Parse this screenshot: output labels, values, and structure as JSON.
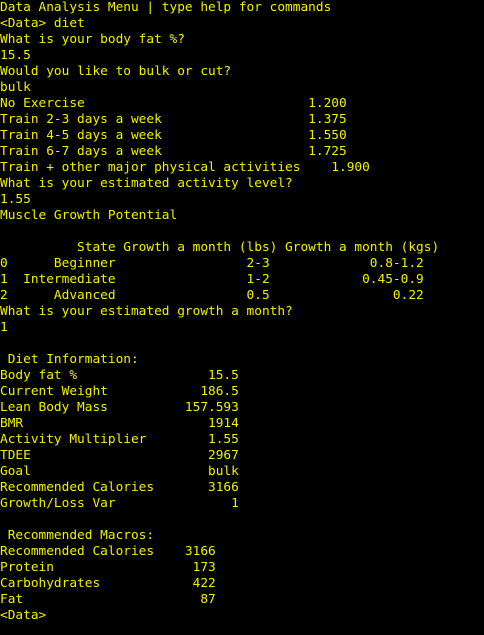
{
  "lines": [
    "Data Analysis Menu | type help for commands",
    "<Data> diet",
    "What is your body fat %?",
    "15.5",
    "Would you like to bulk or cut?",
    "bulk",
    "No Exercise                             1.200",
    "Train 2-3 days a week                   1.375",
    "Train 4-5 days a week                   1.550",
    "Train 6-7 days a week                   1.725",
    "Train + other major physical activities    1.900",
    "What is your estimated activity level?",
    "1.55",
    "Muscle Growth Potential",
    "",
    "          State Growth a month (lbs) Growth a month (kgs)",
    "0      Beginner                 2-3             0.8-1.2",
    "1  Intermediate                 1-2            0.45-0.9",
    "2      Advanced                 0.5                0.22",
    "What is your estimated growth a month?",
    "1",
    "",
    " Diet Information:",
    "Body fat %                 15.5",
    "Current Weight            186.5",
    "Lean Body Mass          157.593",
    "BMR                        1914",
    "Activity Multiplier        1.55",
    "TDEE                       2967",
    "Goal                       bulk",
    "Recommended Calories       3166",
    "Growth/Loss Var               1",
    "",
    " Recommended Macros:",
    "Recommended Calories    3166",
    "Protein                  173",
    "Carbohydrates            422",
    "Fat                       87",
    "<Data>"
  ]
}
